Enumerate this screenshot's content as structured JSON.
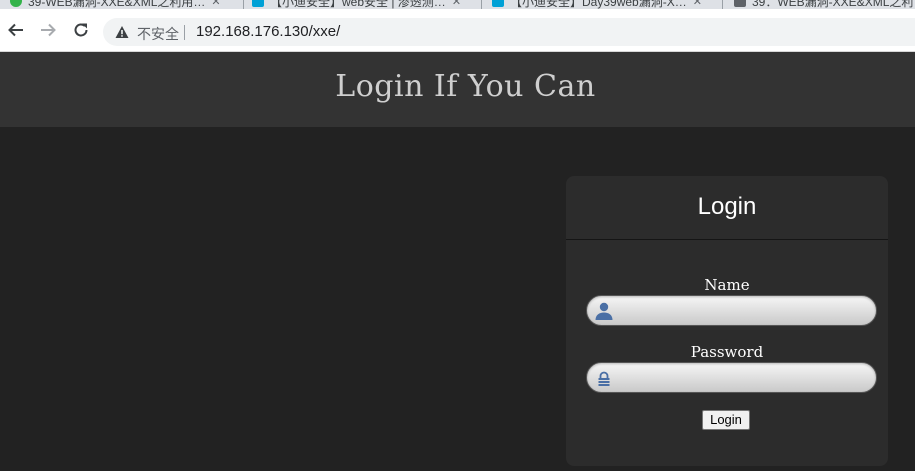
{
  "browser": {
    "tabs": [
      {
        "title": "39-WEB漏洞-XXE&XML之利用…",
        "favicon_color": "#33b34a"
      },
      {
        "title": "【小迪安全】web安全 | 渗透测…",
        "favicon_color": "#00a1d6"
      },
      {
        "title": "【小迪安全】Day39web漏洞-X…",
        "favicon_color": "#00a1d6"
      },
      {
        "title": "39：WEB漏洞-XXE&XML之利…",
        "favicon_color": "#5f6368"
      }
    ],
    "security_label": "不安全",
    "url": "192.168.176.130/xxe/"
  },
  "page": {
    "title": "Login If You Can",
    "login": {
      "heading": "Login",
      "name_label": "Name",
      "name_value": "",
      "password_label": "Password",
      "password_value": "",
      "button_label": "Login"
    }
  },
  "colors": {
    "background": "#222222",
    "header": "#333333",
    "panel": "#2c2c2c",
    "icon_blue": "#4a6fa5"
  }
}
